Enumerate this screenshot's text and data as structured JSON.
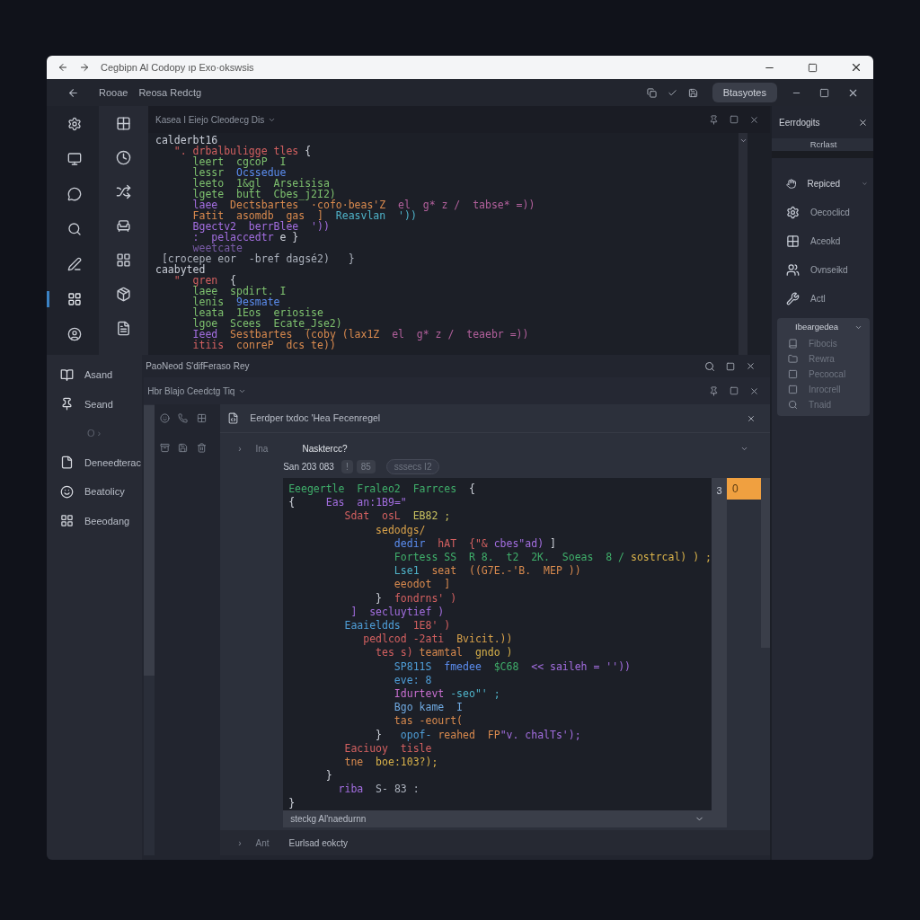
{
  "window": {
    "title": "Cegbipn Al  Codopy ıp Exo·okswsis"
  },
  "toolbar": {
    "items": [
      "Rooae",
      "Reosa Redctg"
    ],
    "button": "Btasyotes"
  },
  "activity_bar": [
    {
      "selected": false
    },
    {
      "selected": false
    },
    {
      "selected": false
    },
    {
      "selected": false
    },
    {
      "selected": false
    },
    {
      "selected": true
    },
    {
      "selected": false
    }
  ],
  "editor": {
    "tab": "Kasea I Eiejo  Cleodecg  Dis",
    "lines": [
      [
        {
          "text": "calderbt16",
          "color": "#c9ced8"
        }
      ],
      [
        {
          "text": "   \". drbalbuligge tles ",
          "color": "#d36060"
        },
        {
          "text": "{",
          "color": "#d0d4dc"
        }
      ],
      [
        {
          "text": "      leert  ",
          "color": "#7ec16e"
        },
        {
          "text": "cgcoP  I",
          "color": "#7ec16e"
        }
      ],
      [
        {
          "text": "      lessr  ",
          "color": "#7ec16e"
        },
        {
          "text": "Ocssedue",
          "color": "#5b8def"
        }
      ],
      [
        {
          "text": "      leeto  1&gl  Arseisisa",
          "color": "#7ec16e"
        }
      ],
      [
        {
          "text": "      lgete  butt  Cbes_j2I2)",
          "color": "#7ec16e"
        }
      ],
      [
        {
          "text": "      laee  ",
          "color": "#a36ee0"
        },
        {
          "text": "Dectsbartes  ·cofo·beas'Z  ",
          "color": "#d98a4e"
        },
        {
          "text": "el  g* z /  tabse* =))",
          "color": "#b2609c"
        }
      ],
      [
        {
          "text": "      Fatit  asomdb  gas  ]  ",
          "color": "#d98a4e"
        },
        {
          "text": "Reasvlan  '))",
          "color": "#4fb3c9"
        }
      ],
      [
        {
          "text": "      Bgectv2  berrBlee  '))",
          "color": "#a36ee0"
        }
      ],
      [
        {
          "text": "      :  pelaccedtr ",
          "color": "#a36ee0"
        },
        {
          "text": "e }",
          "color": "#d0d4dc"
        }
      ],
      [
        {
          "text": "      weetcate",
          "color": "#7a5ca8"
        }
      ],
      [
        {
          "text": " [crocepe eor  -bref dagsé2)   }",
          "color": "#aab0bb"
        }
      ],
      [
        {
          "text": "caabyted",
          "color": "#c9ced8"
        }
      ],
      [
        {
          "text": "   \"  gren  ",
          "color": "#d36060"
        },
        {
          "text": "{",
          "color": "#d0d4dc"
        }
      ],
      [
        {
          "text": "      laee  spdirt. I",
          "color": "#7ec16e"
        }
      ],
      [
        {
          "text": "      lenis  ",
          "color": "#7ec16e"
        },
        {
          "text": "9esmate",
          "color": "#5b8def"
        }
      ],
      [
        {
          "text": "      leata  1Eos  eriosise",
          "color": "#7ec16e"
        }
      ],
      [
        {
          "text": "      lgoe  Scees  Ecate_Jse2)",
          "color": "#7ec16e"
        }
      ],
      [
        {
          "text": "      Ieed  ",
          "color": "#a36ee0"
        },
        {
          "text": "Sestbartes  (coby (lax1Z  ",
          "color": "#d98a4e"
        },
        {
          "text": "el  g* z /  teaebr =))",
          "color": "#b2609c"
        }
      ],
      [
        {
          "text": "      itiis  ",
          "color": "#d36060"
        },
        {
          "text": "conreP  dcs te))",
          "color": "#d98a4e"
        }
      ]
    ]
  },
  "sidebar": {
    "items": [
      {
        "label": "Asand",
        "dim": false
      },
      {
        "label": "Seand",
        "dim": false
      },
      {
        "label": "O ›",
        "dim": true
      },
      {
        "label": "Deneedterac",
        "dim": false
      },
      {
        "label": "Beatolicy",
        "dim": false
      },
      {
        "label": "Beeodang",
        "dim": false
      }
    ]
  },
  "panel": {
    "title": "PaoNeod S'difFeraso Rey",
    "tab": "Hbr Blajo  Ceedctg  Tiq",
    "header": "Eerdper txdoc 'Hea Fecenregel",
    "row": {
      "caret": "›",
      "label": "Ina",
      "value": "Nasktercc?"
    },
    "info": {
      "label": "San 203 083",
      "badges": [
        "!",
        "85"
      ],
      "chip": "sssecs  I2"
    },
    "code": [
      [
        {
          "text": "Eeegertle  Fraleo2  Farrces  ",
          "color": "#3fae6a"
        },
        {
          "text": "{",
          "color": "#d0d4dc"
        }
      ],
      [
        {
          "text": "{     ",
          "color": "#d0d4dc"
        },
        {
          "text": "Eas  ",
          "color": "#a36ee0"
        },
        {
          "text": "an:1B9=\"",
          "color": "#a36ee0"
        }
      ],
      [
        {
          "text": "         Sdat  osL  ",
          "color": "#d36060"
        },
        {
          "text": "EB82 ;",
          "color": "#c9c260"
        }
      ],
      [
        {
          "text": "              sedodgs/",
          "color": "#d9a24a"
        }
      ],
      [
        {
          "text": "                 dedir  ",
          "color": "#5b8def"
        },
        {
          "text": "hAT  {\"& ",
          "color": "#d36060"
        },
        {
          "text": "cbes\"ad)",
          "color": "#a36ee0"
        },
        {
          "text": " ]",
          "color": "#d0d4dc"
        }
      ],
      [
        {
          "text": "                 Fortess SS  R 8.  t2  2K.  Soeas  8 / ",
          "color": "#3fae6a"
        },
        {
          "text": "sostrcal) ) ;",
          "color": "#d9b24a"
        }
      ],
      [
        {
          "text": "                 Lse1  ",
          "color": "#4fb3c9"
        },
        {
          "text": "seat  ((G7E.-'B.  MEP ))",
          "color": "#d98a4e"
        }
      ],
      [
        {
          "text": "                 eeodot  ]",
          "color": "#d98a4e"
        }
      ],
      [
        {
          "text": "              }  ",
          "color": "#d0d4dc"
        },
        {
          "text": "fondrns' )",
          "color": "#d36060"
        }
      ],
      [
        {
          "text": "          ]  secluytief )",
          "color": "#a36ee0"
        }
      ],
      [
        {
          "text": "         Eaaieldds  ",
          "color": "#4f9fd9"
        },
        {
          "text": "1E8' )",
          "color": "#d36060"
        }
      ],
      [
        {
          "text": "            pedlcod -2ati  ",
          "color": "#d36060"
        },
        {
          "text": "Bvicit.))",
          "color": "#d9a24a"
        }
      ],
      [
        {
          "text": "              tes s) ",
          "color": "#d36060"
        },
        {
          "text": "teamtal  ",
          "color": "#d98a4e"
        },
        {
          "text": "gndo )",
          "color": "#d9b24a"
        }
      ],
      [
        {
          "text": "                 SP811S  ",
          "color": "#4f9fd9"
        },
        {
          "text": "fmedee  ",
          "color": "#5b8def"
        },
        {
          "text": "$C68  ",
          "color": "#3fae6a"
        },
        {
          "text": "<< saileh = '')) ",
          "color": "#a36ee0"
        }
      ],
      [
        {
          "text": "                 eve: 8",
          "color": "#4f9fd9"
        }
      ],
      [
        {
          "text": "                 Idurtevt ",
          "color": "#c86fd0"
        },
        {
          "text": "-seo\"' ;",
          "color": "#4fb3c9"
        }
      ],
      [
        {
          "text": "                 Bgo kame  I",
          "color": "#6fa9e0"
        }
      ],
      [
        {
          "text": "                 tas -eourt(",
          "color": "#d98a4e"
        }
      ],
      [
        {
          "text": "              }   ",
          "color": "#d0d4dc"
        },
        {
          "text": "opof- ",
          "color": "#4f9fd9"
        },
        {
          "text": "reahed  FP",
          "color": "#d98a4e"
        },
        {
          "text": "\"v. chalTs');",
          "color": "#a36ee0"
        }
      ],
      [
        {
          "text": "         Eaciuoy  tisle",
          "color": "#d36060"
        }
      ],
      [
        {
          "text": "         tne  ",
          "color": "#d98a4e"
        },
        {
          "text": "boe:103?);",
          "color": "#d9b24a"
        }
      ],
      [
        {
          "text": "      }",
          "color": "#d0d4dc"
        }
      ],
      [
        {
          "text": "        riba  ",
          "color": "#a36ee0"
        },
        {
          "text": "S- 83 :",
          "color": "#aab0bb"
        }
      ],
      [
        {
          "text": "}",
          "color": "#d0d4dc"
        }
      ]
    ],
    "minimap": {
      "line": "3",
      "badge": "0"
    },
    "code_footer": "steckg  Al'naedurnn",
    "bottom_row": {
      "caret": "›",
      "label": "Ant",
      "value": "Eurlsad eokcty"
    }
  },
  "right_panel": {
    "title": "Eerrdogits",
    "tab": "Rcrlast",
    "items": [
      {
        "label": "Repiced",
        "expandable": true
      },
      {
        "label": "Oecoclicd",
        "expandable": false
      },
      {
        "label": "Aceokd",
        "expandable": false
      },
      {
        "label": "Ovnseikd",
        "expandable": false
      },
      {
        "label": "Actl",
        "expandable": false
      }
    ],
    "group": {
      "label": "Ibeargedea",
      "expanded": true,
      "children": [
        "Fibocis",
        "Rewra",
        "Pecoocal",
        "Inrocrell",
        "Tnaid"
      ]
    }
  }
}
